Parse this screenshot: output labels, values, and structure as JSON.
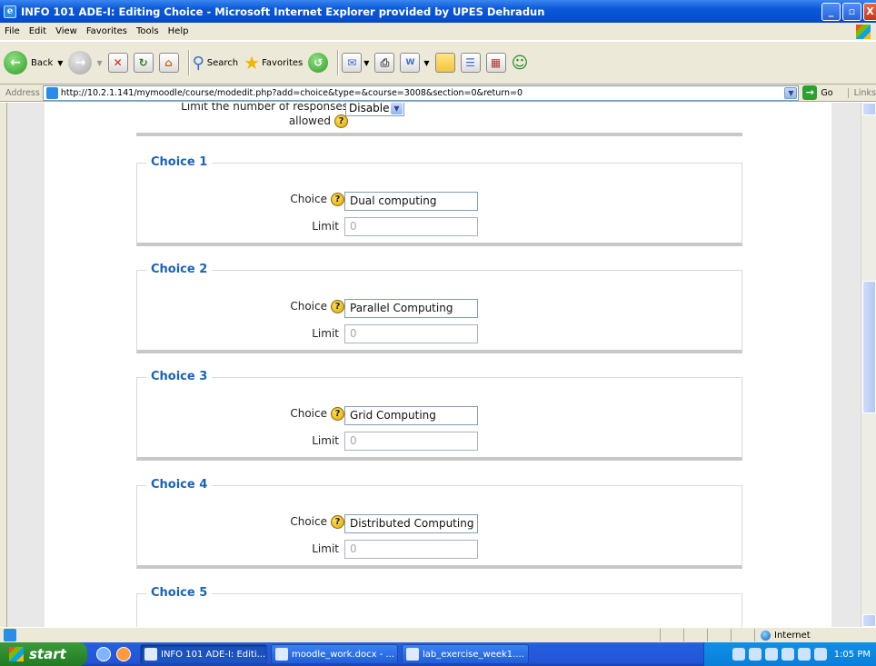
{
  "window": {
    "title": "INFO 101 ADE-I: Editing Choice - Microsoft Internet Explorer provided by UPES Dehradun",
    "minimize": "_",
    "maximize": "▫",
    "close": "X"
  },
  "menu": [
    "File",
    "Edit",
    "View",
    "Favorites",
    "Tools",
    "Help"
  ],
  "toolbar": {
    "back_label": "Back",
    "search_label": "Search",
    "favorites_label": "Favorites"
  },
  "address": {
    "label": "Address",
    "url": "http://10.2.1.141/mymoodle/course/modedit.php?add=choice&type=&course=3008&section=0&return=0",
    "go_label": "Go",
    "links_label": "Links"
  },
  "form": {
    "limit_label_line1": "Limit the number of responses",
    "limit_label_line2": "allowed",
    "limit_value": "Disable",
    "choice_field_label": "Choice",
    "limit_field_label": "Limit",
    "limit_placeholder": "0",
    "choices": [
      {
        "legend": "Choice 1",
        "value": "Dual computing"
      },
      {
        "legend": "Choice 2",
        "value": "Parallel Computing"
      },
      {
        "legend": "Choice 3",
        "value": "Grid Computing"
      },
      {
        "legend": "Choice 4",
        "value": "Distributed Computing"
      },
      {
        "legend": "Choice 5",
        "value": ""
      }
    ]
  },
  "status": {
    "zone": "Internet"
  },
  "taskbar": {
    "start_label": "start",
    "tasks": [
      {
        "label": "INFO 101 ADE-I: Editi..."
      },
      {
        "label": "moodle_work.docx - ..."
      },
      {
        "label": "lab_exercise_week1...."
      }
    ],
    "clock": "1:05 PM"
  }
}
